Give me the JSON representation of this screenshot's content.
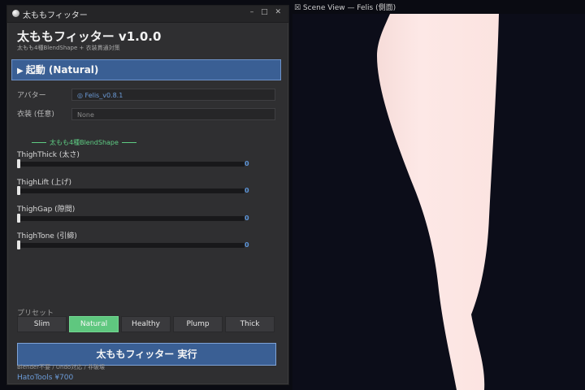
{
  "window": {
    "title": "太ももフィッター",
    "controls": "– □ ✕"
  },
  "app": {
    "title": "太ももフィッター v1.0.0",
    "subtitle": "太もも4種BlendShape + 衣装貫通対策"
  },
  "run_button": {
    "icon": "play-triangle",
    "label": "起動 (Natural)"
  },
  "fields": {
    "avatar_label": "アバター",
    "avatar_value": "◎ Felis_v0.8.1",
    "outfit_label": "衣装 (任意)",
    "outfit_value": "None"
  },
  "section": {
    "title": "太もも4種BlendShape"
  },
  "sliders": [
    {
      "label": "ThighThick (太さ)",
      "value": "0"
    },
    {
      "label": "ThighLift (上げ)",
      "value": "0"
    },
    {
      "label": "ThighGap (隙間)",
      "value": "0"
    },
    {
      "label": "ThighTone (引締)",
      "value": "0"
    }
  ],
  "presets": {
    "label": "プリセット",
    "items": [
      "Slim",
      "Natural",
      "Healthy",
      "Plump",
      "Thick"
    ],
    "selected": "Natural"
  },
  "execute_button": {
    "label": "太ももフィッター 実行"
  },
  "footer": {
    "note": "Blender不要 / Undo対応 / 非破壊",
    "brand": "HatoTools ¥700"
  },
  "scene": {
    "header": "☒ Scene View — Felis (側面)"
  },
  "colors": {
    "accent_blue": "#3a5f94",
    "accent_green": "#5fc77f",
    "panel_bg": "#2f2f31",
    "scene_bg": "#0c0d19",
    "skin": "#fde8e6"
  }
}
